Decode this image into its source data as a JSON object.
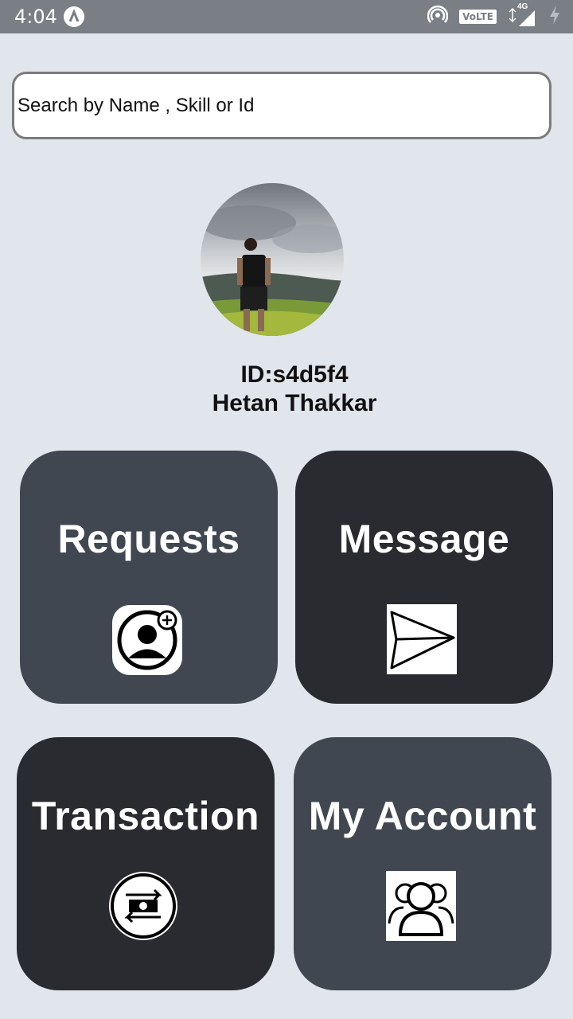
{
  "status_bar": {
    "time": "4:04",
    "network_label": "VoLTE",
    "signal_type": "4G"
  },
  "search": {
    "placeholder": "Search by Name , Skill or Id"
  },
  "profile": {
    "id_text": "ID:s4d5f4",
    "name": "Hetan Thakkar"
  },
  "cards": {
    "requests": {
      "label": "Requests",
      "icon": "add-user-icon",
      "color": "#414750"
    },
    "message": {
      "label": "Message",
      "icon": "send-icon",
      "color": "#292b30"
    },
    "transaction": {
      "label": "Transaction",
      "icon": "money-transfer-icon",
      "color": "#292b30"
    },
    "account": {
      "label": "My Account",
      "icon": "group-users-icon",
      "color": "#414750"
    }
  }
}
